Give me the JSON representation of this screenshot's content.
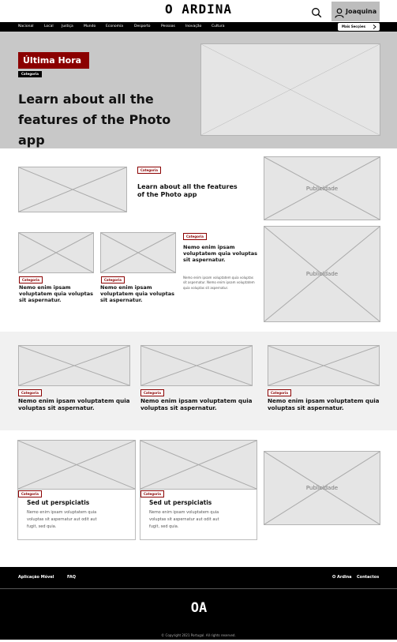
{
  "header": {
    "logo": "O ARDINA",
    "user_name": "Joaquina"
  },
  "nav": {
    "items": [
      "Nacional",
      "Local",
      "Justiça",
      "Mundo",
      "Economia",
      "Desporto",
      "Pessoas",
      "Inovação",
      "Cultura"
    ],
    "more": "Mais Secções"
  },
  "hero": {
    "badge": "Última Hora",
    "category": "Categoria",
    "title": "Learn about all the features of the Photo app"
  },
  "featured": {
    "category": "Categoria",
    "title": "Learn about all the features of the Photo app"
  },
  "ads": {
    "label": "Publicidade"
  },
  "small_cards": [
    {
      "category": "Categoria",
      "title": "Nemo enim ipsam voluptatem quia voluptas sit aspernatur."
    },
    {
      "category": "Categoria",
      "title": "Nemo enim ipsam voluptatem quia voluptas sit aspernatur."
    },
    {
      "category": "Categoria",
      "title": "Nemo enim ipsam voluptatem quia voluptas sit aspernatur.",
      "summary": "Nemo enim ipsam voluptatem quia voluptas sit aspernatur. Nemo enim ipsam voluptatem quia voluptas sit aspernatur."
    }
  ],
  "grey_cards": [
    {
      "category": "Categoria",
      "title": "Nemo enim ipsam voluptatem quia voluptas sit aspernatur."
    },
    {
      "category": "Categoria",
      "title": "Nemo enim ipsam voluptatem quia voluptas sit aspernatur."
    },
    {
      "category": "Categoria",
      "title": "Nemo enim ipsam voluptatem quia voluptas sit aspernatur."
    }
  ],
  "bottom_cards": [
    {
      "category": "Categoria",
      "title": "Sed ut perspiciatis",
      "text": "Nemo enim ipsam voluptatem quia voluptas sit aspernatur aut odit aut fugit, sed quia."
    },
    {
      "category": "Categoria",
      "title": "Sed ut perspiciatis",
      "text": "Nemo enim ipsam voluptatem quia voluptas sit aspernatur aut odit aut fugit, sed quia."
    }
  ],
  "footer": {
    "links_left": [
      "Aplicação Móvel",
      "FAQ"
    ],
    "links_right": [
      "O Ardina",
      "Contactos"
    ],
    "logo": "OA",
    "copyright": "© Copyright 2021 Portugal. All rights reserved."
  },
  "icons": {
    "search": "search-icon",
    "user": "user-icon",
    "chevron": "chevron-right-icon"
  }
}
